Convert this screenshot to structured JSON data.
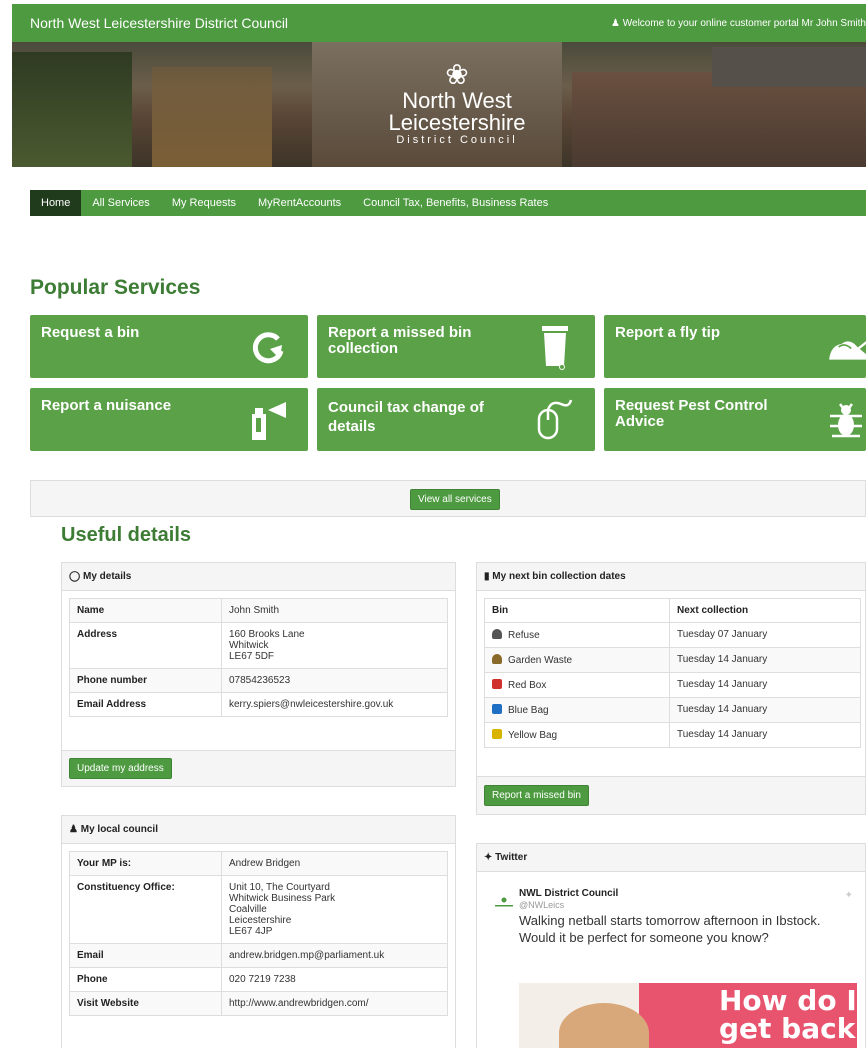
{
  "header": {
    "site_title": "North West Leicestershire District Council",
    "welcome": "Welcome to your online customer portal Mr John Smith"
  },
  "logo": {
    "line1": "North West",
    "line2": "Leicestershire",
    "line3": "District Council"
  },
  "nav": [
    {
      "label": "Home",
      "active": true
    },
    {
      "label": "All Services"
    },
    {
      "label": "My Requests"
    },
    {
      "label": "MyRentAccounts"
    },
    {
      "label": "Council Tax, Benefits, Business Rates"
    }
  ],
  "popular": {
    "title": "Popular Services",
    "tiles": [
      {
        "label": "Request a bin",
        "icon": "refresh-arrow-icon"
      },
      {
        "label": "Report a missed bin collection",
        "icon": "wheelie-bin-icon"
      },
      {
        "label": "Report a fly tip",
        "icon": "fly-tip-icon"
      },
      {
        "label": "Report a nuisance",
        "icon": "spray-can-icon"
      },
      {
        "label": "Council tax change of details",
        "icon": "computer-mouse-icon"
      },
      {
        "label": "Request Pest Control Advice",
        "icon": "bug-icon"
      }
    ],
    "view_all": "View all services"
  },
  "useful": {
    "title": "Useful details",
    "my_details": {
      "heading": "My details",
      "rows": [
        {
          "label": "Name",
          "value": "John Smith"
        },
        {
          "label": "Address",
          "value": [
            "160 Brooks Lane",
            "Whitwick",
            "LE67 5DF"
          ]
        },
        {
          "label": "Phone number",
          "value": "07854236523"
        },
        {
          "label": "Email Address",
          "value": "kerry.spiers@nwleicestershire.gov.uk"
        }
      ],
      "button": "Update my address"
    },
    "bins": {
      "heading": "My next bin collection dates",
      "col_bin": "Bin",
      "col_next": "Next collection",
      "rows": [
        {
          "bin": "Refuse",
          "date": "Tuesday 07 January",
          "color": "#555555"
        },
        {
          "bin": "Garden Waste",
          "date": "Tuesday 14 January",
          "color": "#8a6a2a"
        },
        {
          "bin": "Red Box",
          "date": "Tuesday 14 January",
          "color": "#d0312d"
        },
        {
          "bin": "Blue Bag",
          "date": "Tuesday 14 January",
          "color": "#1f6fc4"
        },
        {
          "bin": "Yellow Bag",
          "date": "Tuesday 14 January",
          "color": "#d8b400"
        }
      ],
      "button": "Report a missed bin"
    },
    "local_council": {
      "heading": "My local council",
      "rows": [
        {
          "label": "Your MP is:",
          "value": "Andrew Bridgen"
        },
        {
          "label": "Constituency Office:",
          "value": [
            "Unit 10, The Courtyard",
            "Whitwick Business Park",
            "Coalville",
            "Leicestershire",
            "LE67 4JP"
          ]
        },
        {
          "label": "Email",
          "value": "andrew.bridgen.mp@parliament.uk"
        },
        {
          "label": "Phone",
          "value": "020 7219 7238"
        },
        {
          "label": "Visit Website",
          "value": "http://www.andrewbridgen.com/"
        }
      ]
    },
    "twitter": {
      "heading": "Twitter",
      "author": "NWL District Council",
      "handle": "@NWLeics",
      "text": "Walking netball starts tomorrow afternoon in Ibstock. Would it be perfect for someone you know?",
      "image_text": "How do I get back"
    }
  },
  "colors": {
    "brand_green": "#4d9a40",
    "tile_green": "#5ba148",
    "heading_green": "#3d7c34"
  }
}
